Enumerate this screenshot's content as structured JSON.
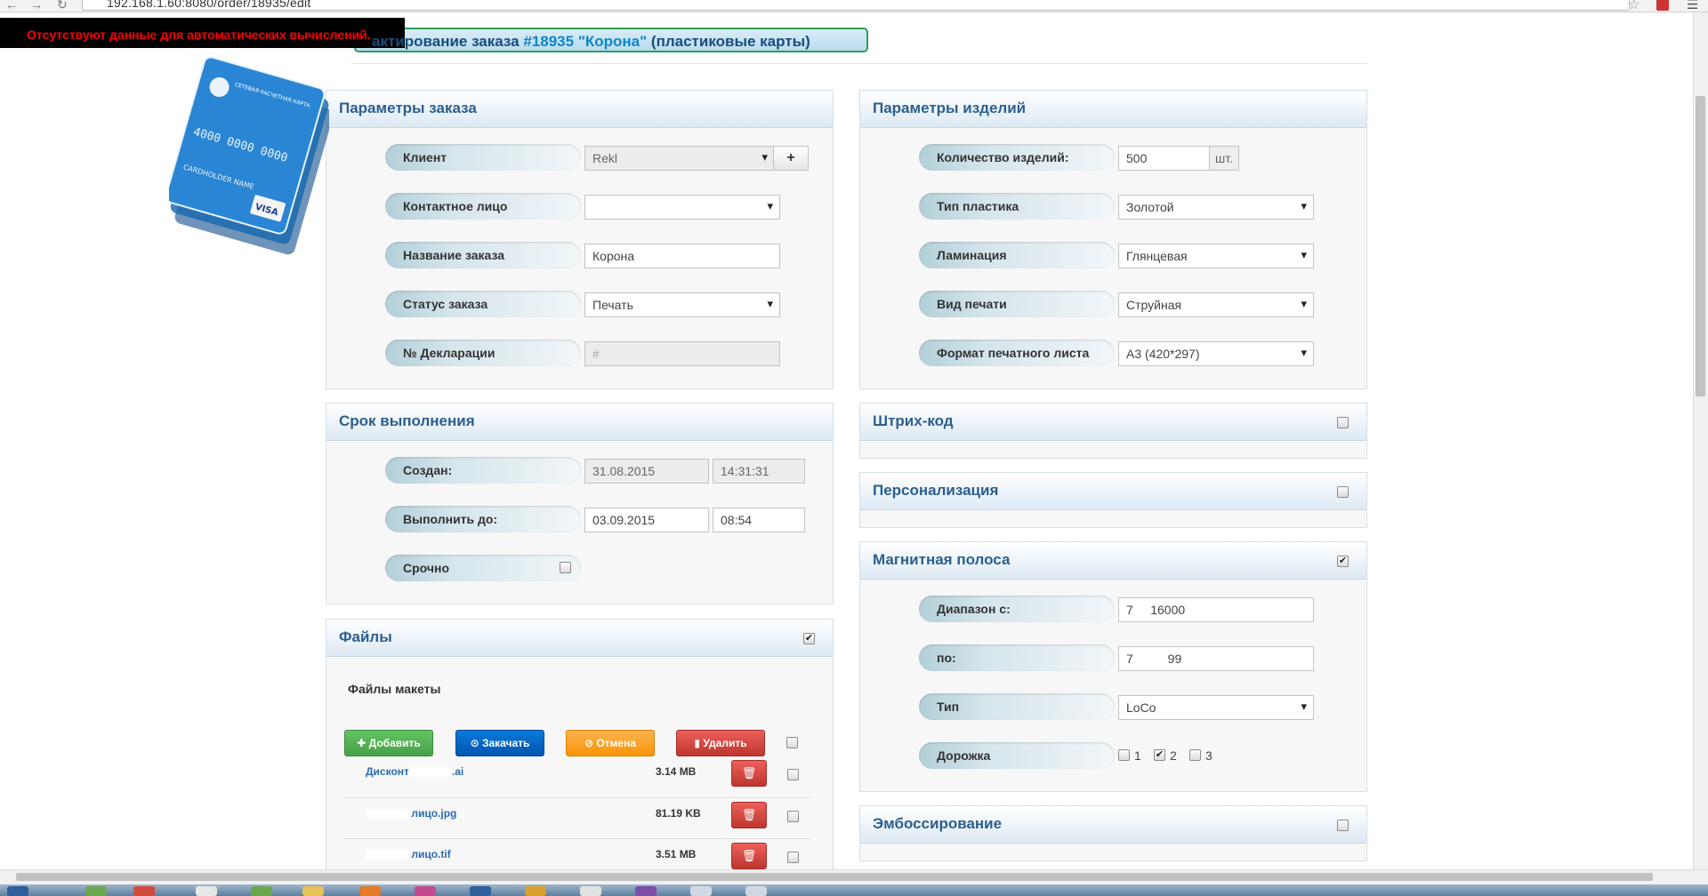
{
  "browser": {
    "url": "192.168.1.60:8080/order/18935/edit"
  },
  "warning": "Отсутствуют данные для автоматических вычислений.",
  "header": {
    "title_prefix": "актирование заказа ",
    "order_id": "#18935",
    "order_name": "\"Корона\"",
    "title_suffix": " (пластиковые карты)"
  },
  "card_image": {
    "bank": "СЕТЕВАЯ РАСЧЕТНАЯ КАРТА",
    "number": "4000 0000 0000",
    "holder": "CARDHOLDER NAME",
    "brand": "VISA"
  },
  "order_params": {
    "title": "Параметры заказа",
    "client_label": "Клиент",
    "client_value": "Rekl",
    "contact_label": "Контактное лицо",
    "contact_value": "",
    "name_label": "Название заказа",
    "name_value": "Корона",
    "status_label": "Статус заказа",
    "status_value": "Печать",
    "decl_label": "№ Декларации",
    "decl_placeholder": "#"
  },
  "deadline": {
    "title": "Срок выполнения",
    "created_label": "Создан:",
    "created_date": "31.08.2015",
    "created_time": "14:31:31",
    "due_label": "Выполнить до:",
    "due_date": "03.09.2015",
    "due_time": "08:54",
    "urgent_label": "Срочно",
    "urgent_checked": false
  },
  "files": {
    "title": "Файлы",
    "checked": true,
    "subtitle": "Файлы макеты",
    "buttons": {
      "add": "Добавить",
      "upload": "Закачать",
      "cancel": "Отмена",
      "delete": "Удалить"
    },
    "items": [
      {
        "name_start": "Дисконт",
        "name_end": ".ai",
        "size": "3.14 MB"
      },
      {
        "name_start": "",
        "name_end": " лицо.jpg",
        "size": "81.19 KB"
      },
      {
        "name_start": "",
        "name_end": " лицо.tif",
        "size": "3.51 MB"
      }
    ]
  },
  "product_params": {
    "title": "Параметры изделий",
    "qty_label": "Количество изделий:",
    "qty_value": "500",
    "qty_unit": "шт.",
    "plastic_label": "Тип пластика",
    "plastic_value": "Золотой",
    "lamination_label": "Ламинация",
    "lamination_value": "Глянцевая",
    "print_label": "Вид печати",
    "print_value": "Струйная",
    "format_label": "Формат печатного листа",
    "format_value": "А3 (420*297)"
  },
  "barcode": {
    "title": "Штрих-код",
    "checked": false
  },
  "personalization": {
    "title": "Персонализация",
    "checked": false
  },
  "magnetic": {
    "title": "Магнитная полоса",
    "checked": true,
    "from_label": "Диапазон с:",
    "from_value": "7     16000",
    "to_label": "по:",
    "to_value": "7          99",
    "type_label": "Тип",
    "type_value": "LoCo",
    "track_label": "Дорожка",
    "tracks": [
      {
        "num": "1",
        "checked": false
      },
      {
        "num": "2",
        "checked": true
      },
      {
        "num": "3",
        "checked": false
      }
    ]
  },
  "embossing": {
    "title": "Эмбоссирование",
    "checked": false
  }
}
